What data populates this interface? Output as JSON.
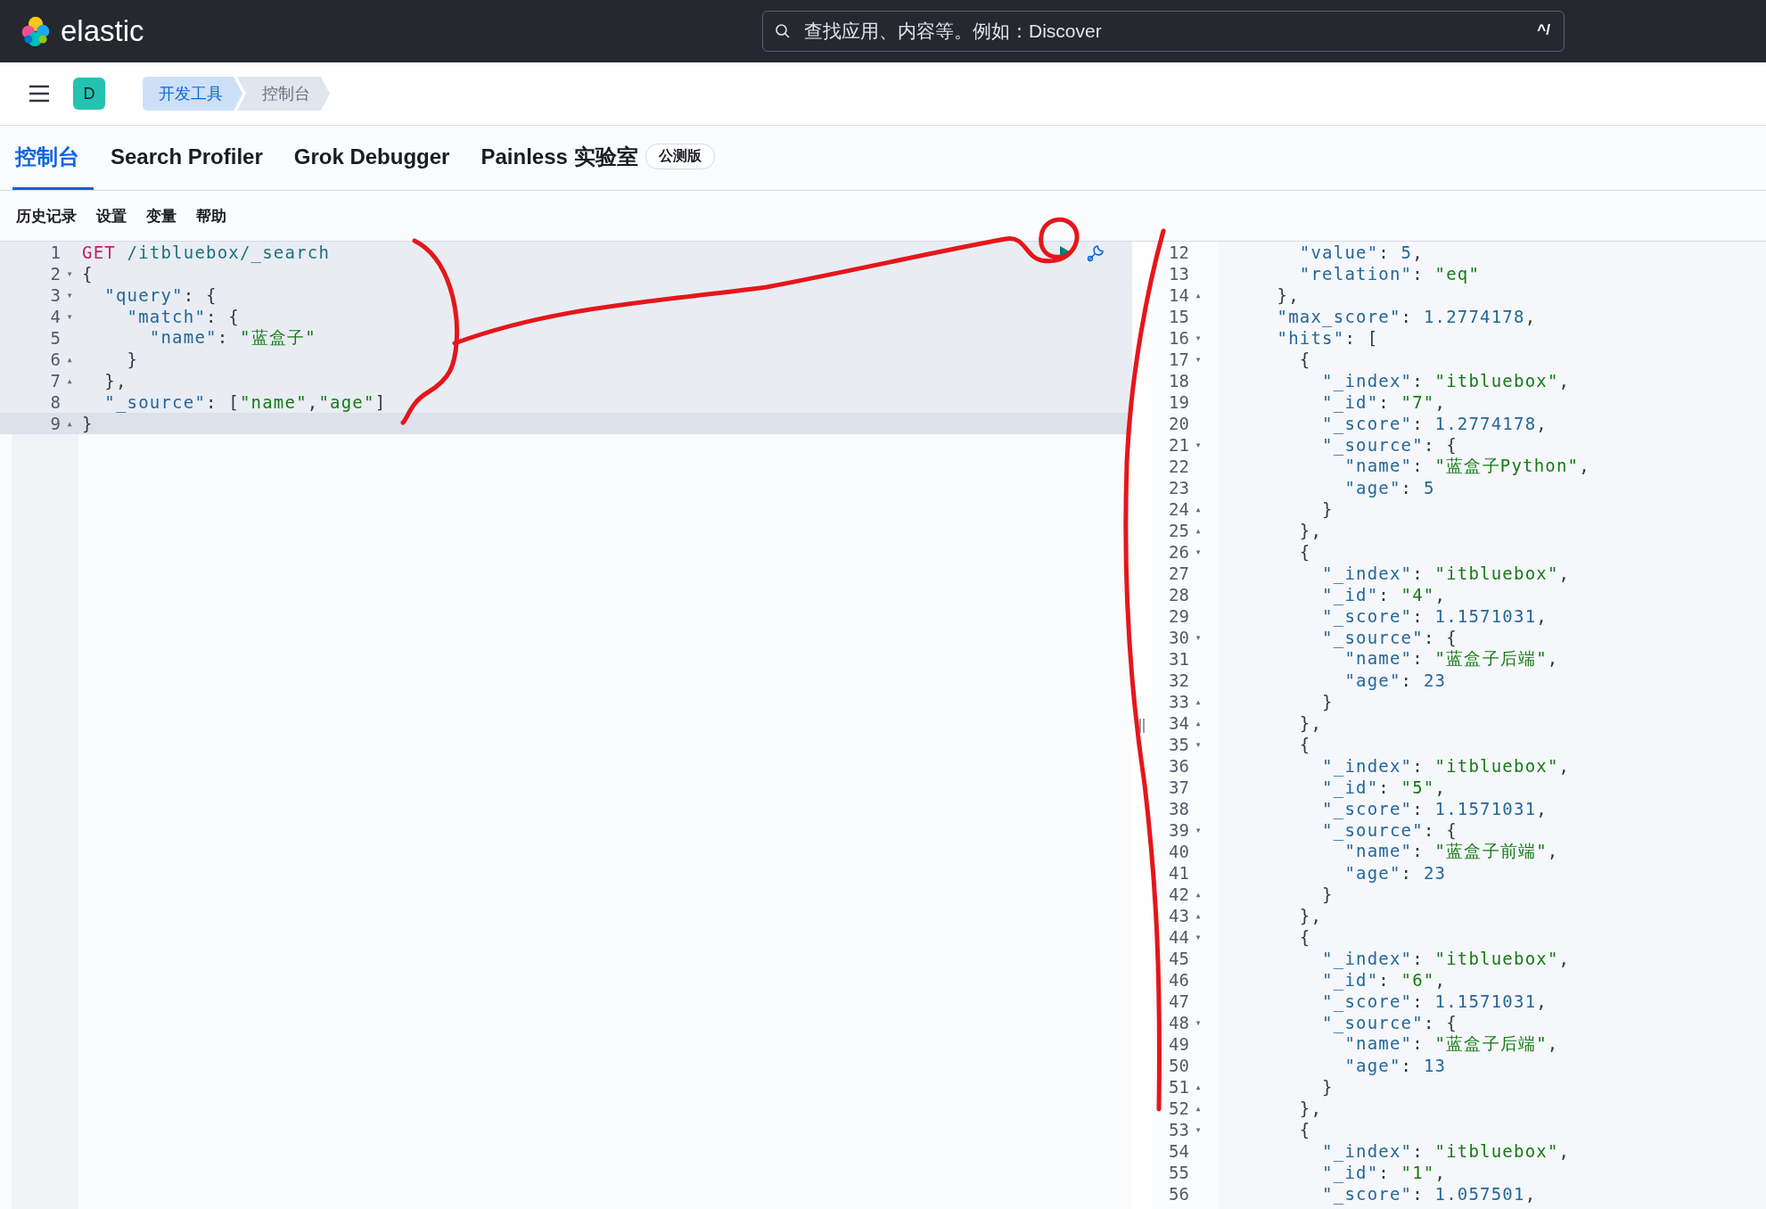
{
  "header": {
    "brand": "elastic",
    "search": {
      "placeholder": "查找应用、内容等。例如：Discover",
      "shortcut": "^/"
    }
  },
  "breadcrumbs": {
    "avatar": "D",
    "items": [
      {
        "label": "开发工具",
        "selected": false
      },
      {
        "label": "控制台",
        "selected": true
      }
    ]
  },
  "tabs": [
    {
      "label": "控制台",
      "selected": true
    },
    {
      "label": "Search Profiler",
      "selected": false
    },
    {
      "label": "Grok Debugger",
      "selected": false
    },
    {
      "label": "Painless 实验室",
      "selected": false,
      "badge": "公测版"
    }
  ],
  "toolbar": [
    "历史记录",
    "设置",
    "变量",
    "帮助"
  ],
  "hand_drawn_marks": true,
  "request": [
    {
      "n": "1",
      "active": false,
      "code": [
        {
          "kind": "method",
          "t": "GET"
        },
        {
          "kind": "path",
          "t": " /itbluebox/_search"
        }
      ]
    },
    {
      "n": "2",
      "fold": "▾",
      "active": false,
      "code": [
        {
          "kind": "punct",
          "t": "{"
        }
      ]
    },
    {
      "n": "3",
      "fold": "▾",
      "active": false,
      "code": [
        {
          "kind": "key",
          "t": "  \"query\""
        },
        {
          "kind": "punct",
          "t": ": {"
        }
      ]
    },
    {
      "n": "4",
      "fold": "▾",
      "active": false,
      "code": [
        {
          "kind": "key",
          "t": "    \"match\""
        },
        {
          "kind": "punct",
          "t": ": {"
        }
      ]
    },
    {
      "n": "5",
      "active": false,
      "code": [
        {
          "kind": "key",
          "t": "      \"name\""
        },
        {
          "kind": "punct",
          "t": ": "
        },
        {
          "kind": "string",
          "t": "\"蓝盒子\""
        }
      ]
    },
    {
      "n": "6",
      "fold": "▴",
      "active": false,
      "code": [
        {
          "kind": "punct",
          "t": "    }"
        }
      ]
    },
    {
      "n": "7",
      "fold": "▴",
      "active": false,
      "code": [
        {
          "kind": "punct",
          "t": "  },"
        }
      ]
    },
    {
      "n": "8",
      "active": false,
      "code": [
        {
          "kind": "key",
          "t": "  \"_source\""
        },
        {
          "kind": "punct",
          "t": ": ["
        },
        {
          "kind": "string",
          "t": "\"name\""
        },
        {
          "kind": "punct",
          "t": ","
        },
        {
          "kind": "string",
          "t": "\"age\""
        },
        {
          "kind": "punct",
          "t": "]"
        }
      ]
    },
    {
      "n": "9",
      "fold": "▴",
      "active": true,
      "code": [
        {
          "kind": "punct",
          "t": "}"
        }
      ]
    }
  ],
  "response": [
    {
      "n": "12",
      "code": [
        {
          "kind": "key",
          "t": "      \"value\""
        },
        {
          "kind": "punct",
          "t": ": "
        },
        {
          "kind": "number",
          "t": "5"
        },
        {
          "kind": "punct",
          "t": ","
        }
      ]
    },
    {
      "n": "13",
      "code": [
        {
          "kind": "key",
          "t": "      \"relation\""
        },
        {
          "kind": "punct",
          "t": ": "
        },
        {
          "kind": "string",
          "t": "\"eq\""
        }
      ]
    },
    {
      "n": "14",
      "fold": "▴",
      "code": [
        {
          "kind": "punct",
          "t": "    },"
        }
      ]
    },
    {
      "n": "15",
      "code": [
        {
          "kind": "key",
          "t": "    \"max_score\""
        },
        {
          "kind": "punct",
          "t": ": "
        },
        {
          "kind": "number",
          "t": "1.2774178"
        },
        {
          "kind": "punct",
          "t": ","
        }
      ]
    },
    {
      "n": "16",
      "fold": "▾",
      "code": [
        {
          "kind": "key",
          "t": "    \"hits\""
        },
        {
          "kind": "punct",
          "t": ": ["
        }
      ]
    },
    {
      "n": "17",
      "fold": "▾",
      "code": [
        {
          "kind": "punct",
          "t": "      {"
        }
      ]
    },
    {
      "n": "18",
      "code": [
        {
          "kind": "key",
          "t": "        \"_index\""
        },
        {
          "kind": "punct",
          "t": ": "
        },
        {
          "kind": "string",
          "t": "\"itbluebox\""
        },
        {
          "kind": "punct",
          "t": ","
        }
      ]
    },
    {
      "n": "19",
      "code": [
        {
          "kind": "key",
          "t": "        \"_id\""
        },
        {
          "kind": "punct",
          "t": ": "
        },
        {
          "kind": "string",
          "t": "\"7\""
        },
        {
          "kind": "punct",
          "t": ","
        }
      ]
    },
    {
      "n": "20",
      "code": [
        {
          "kind": "key",
          "t": "        \"_score\""
        },
        {
          "kind": "punct",
          "t": ": "
        },
        {
          "kind": "number",
          "t": "1.2774178"
        },
        {
          "kind": "punct",
          "t": ","
        }
      ]
    },
    {
      "n": "21",
      "fold": "▾",
      "code": [
        {
          "kind": "key",
          "t": "        \"_source\""
        },
        {
          "kind": "punct",
          "t": ": {"
        }
      ]
    },
    {
      "n": "22",
      "code": [
        {
          "kind": "key",
          "t": "          \"name\""
        },
        {
          "kind": "punct",
          "t": ": "
        },
        {
          "kind": "string",
          "t": "\"蓝盒子Python\""
        },
        {
          "kind": "punct",
          "t": ","
        }
      ]
    },
    {
      "n": "23",
      "code": [
        {
          "kind": "key",
          "t": "          \"age\""
        },
        {
          "kind": "punct",
          "t": ": "
        },
        {
          "kind": "number",
          "t": "5"
        }
      ]
    },
    {
      "n": "24",
      "fold": "▴",
      "code": [
        {
          "kind": "punct",
          "t": "        }"
        }
      ]
    },
    {
      "n": "25",
      "fold": "▴",
      "code": [
        {
          "kind": "punct",
          "t": "      },"
        }
      ]
    },
    {
      "n": "26",
      "fold": "▾",
      "code": [
        {
          "kind": "punct",
          "t": "      {"
        }
      ]
    },
    {
      "n": "27",
      "code": [
        {
          "kind": "key",
          "t": "        \"_index\""
        },
        {
          "kind": "punct",
          "t": ": "
        },
        {
          "kind": "string",
          "t": "\"itbluebox\""
        },
        {
          "kind": "punct",
          "t": ","
        }
      ]
    },
    {
      "n": "28",
      "code": [
        {
          "kind": "key",
          "t": "        \"_id\""
        },
        {
          "kind": "punct",
          "t": ": "
        },
        {
          "kind": "string",
          "t": "\"4\""
        },
        {
          "kind": "punct",
          "t": ","
        }
      ]
    },
    {
      "n": "29",
      "code": [
        {
          "kind": "key",
          "t": "        \"_score\""
        },
        {
          "kind": "punct",
          "t": ": "
        },
        {
          "kind": "number",
          "t": "1.1571031"
        },
        {
          "kind": "punct",
          "t": ","
        }
      ]
    },
    {
      "n": "30",
      "fold": "▾",
      "code": [
        {
          "kind": "key",
          "t": "        \"_source\""
        },
        {
          "kind": "punct",
          "t": ": {"
        }
      ]
    },
    {
      "n": "31",
      "code": [
        {
          "kind": "key",
          "t": "          \"name\""
        },
        {
          "kind": "punct",
          "t": ": "
        },
        {
          "kind": "string",
          "t": "\"蓝盒子后端\""
        },
        {
          "kind": "punct",
          "t": ","
        }
      ]
    },
    {
      "n": "32",
      "code": [
        {
          "kind": "key",
          "t": "          \"age\""
        },
        {
          "kind": "punct",
          "t": ": "
        },
        {
          "kind": "number",
          "t": "23"
        }
      ]
    },
    {
      "n": "33",
      "fold": "▴",
      "code": [
        {
          "kind": "punct",
          "t": "        }"
        }
      ]
    },
    {
      "n": "34",
      "fold": "▴",
      "code": [
        {
          "kind": "punct",
          "t": "      },"
        }
      ]
    },
    {
      "n": "35",
      "fold": "▾",
      "code": [
        {
          "kind": "punct",
          "t": "      {"
        }
      ]
    },
    {
      "n": "36",
      "code": [
        {
          "kind": "key",
          "t": "        \"_index\""
        },
        {
          "kind": "punct",
          "t": ": "
        },
        {
          "kind": "string",
          "t": "\"itbluebox\""
        },
        {
          "kind": "punct",
          "t": ","
        }
      ]
    },
    {
      "n": "37",
      "code": [
        {
          "kind": "key",
          "t": "        \"_id\""
        },
        {
          "kind": "punct",
          "t": ": "
        },
        {
          "kind": "string",
          "t": "\"5\""
        },
        {
          "kind": "punct",
          "t": ","
        }
      ]
    },
    {
      "n": "38",
      "code": [
        {
          "kind": "key",
          "t": "        \"_score\""
        },
        {
          "kind": "punct",
          "t": ": "
        },
        {
          "kind": "number",
          "t": "1.1571031"
        },
        {
          "kind": "punct",
          "t": ","
        }
      ]
    },
    {
      "n": "39",
      "fold": "▾",
      "code": [
        {
          "kind": "key",
          "t": "        \"_source\""
        },
        {
          "kind": "punct",
          "t": ": {"
        }
      ]
    },
    {
      "n": "40",
      "code": [
        {
          "kind": "key",
          "t": "          \"name\""
        },
        {
          "kind": "punct",
          "t": ": "
        },
        {
          "kind": "string",
          "t": "\"蓝盒子前端\""
        },
        {
          "kind": "punct",
          "t": ","
        }
      ]
    },
    {
      "n": "41",
      "code": [
        {
          "kind": "key",
          "t": "          \"age\""
        },
        {
          "kind": "punct",
          "t": ": "
        },
        {
          "kind": "number",
          "t": "23"
        }
      ]
    },
    {
      "n": "42",
      "fold": "▴",
      "code": [
        {
          "kind": "punct",
          "t": "        }"
        }
      ]
    },
    {
      "n": "43",
      "fold": "▴",
      "code": [
        {
          "kind": "punct",
          "t": "      },"
        }
      ]
    },
    {
      "n": "44",
      "fold": "▾",
      "code": [
        {
          "kind": "punct",
          "t": "      {"
        }
      ]
    },
    {
      "n": "45",
      "code": [
        {
          "kind": "key",
          "t": "        \"_index\""
        },
        {
          "kind": "punct",
          "t": ": "
        },
        {
          "kind": "string",
          "t": "\"itbluebox\""
        },
        {
          "kind": "punct",
          "t": ","
        }
      ]
    },
    {
      "n": "46",
      "code": [
        {
          "kind": "key",
          "t": "        \"_id\""
        },
        {
          "kind": "punct",
          "t": ": "
        },
        {
          "kind": "string",
          "t": "\"6\""
        },
        {
          "kind": "punct",
          "t": ","
        }
      ]
    },
    {
      "n": "47",
      "code": [
        {
          "kind": "key",
          "t": "        \"_score\""
        },
        {
          "kind": "punct",
          "t": ": "
        },
        {
          "kind": "number",
          "t": "1.1571031"
        },
        {
          "kind": "punct",
          "t": ","
        }
      ]
    },
    {
      "n": "48",
      "fold": "▾",
      "code": [
        {
          "kind": "key",
          "t": "        \"_source\""
        },
        {
          "kind": "punct",
          "t": ": {"
        }
      ]
    },
    {
      "n": "49",
      "code": [
        {
          "kind": "key",
          "t": "          \"name\""
        },
        {
          "kind": "punct",
          "t": ": "
        },
        {
          "kind": "string",
          "t": "\"蓝盒子后端\""
        },
        {
          "kind": "punct",
          "t": ","
        }
      ]
    },
    {
      "n": "50",
      "code": [
        {
          "kind": "key",
          "t": "          \"age\""
        },
        {
          "kind": "punct",
          "t": ": "
        },
        {
          "kind": "number",
          "t": "13"
        }
      ]
    },
    {
      "n": "51",
      "fold": "▴",
      "code": [
        {
          "kind": "punct",
          "t": "        }"
        }
      ]
    },
    {
      "n": "52",
      "fold": "▴",
      "code": [
        {
          "kind": "punct",
          "t": "      },"
        }
      ]
    },
    {
      "n": "53",
      "fold": "▾",
      "code": [
        {
          "kind": "punct",
          "t": "      {"
        }
      ]
    },
    {
      "n": "54",
      "code": [
        {
          "kind": "key",
          "t": "        \"_index\""
        },
        {
          "kind": "punct",
          "t": ": "
        },
        {
          "kind": "string",
          "t": "\"itbluebox\""
        },
        {
          "kind": "punct",
          "t": ","
        }
      ]
    },
    {
      "n": "55",
      "code": [
        {
          "kind": "key",
          "t": "        \"_id\""
        },
        {
          "kind": "punct",
          "t": ": "
        },
        {
          "kind": "string",
          "t": "\"1\""
        },
        {
          "kind": "punct",
          "t": ","
        }
      ]
    },
    {
      "n": "56",
      "code": [
        {
          "kind": "key",
          "t": "        \"_score\""
        },
        {
          "kind": "punct",
          "t": ": "
        },
        {
          "kind": "number",
          "t": "1.057501"
        },
        {
          "kind": "punct",
          "t": ","
        }
      ]
    }
  ]
}
